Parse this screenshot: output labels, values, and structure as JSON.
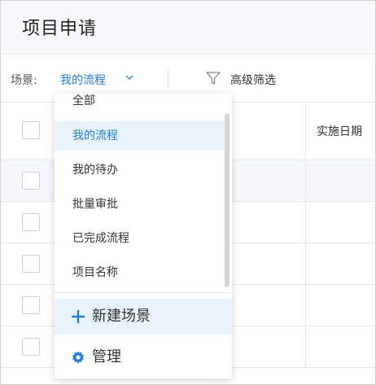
{
  "page": {
    "title": "项目申请"
  },
  "filter_bar": {
    "scene_label": "场景:",
    "scene_value": "我的流程",
    "advanced_filter_label": "高级筛选"
  },
  "table": {
    "header_date_label": "实施日期"
  },
  "scene_dropdown": {
    "items": [
      "全部",
      "我的流程",
      "我的待办",
      "批量审批",
      "已完成流程",
      "项目名称"
    ],
    "selected": "我的流程",
    "new_scene_label": "新建场景",
    "manage_label": "管理"
  },
  "colors": {
    "accent": "#1e7fe6",
    "selected_bg": "#e8f3fc"
  },
  "icons": {
    "chevron": "chevron-down-icon",
    "filter": "filter-icon",
    "plus": "plus-icon",
    "gear": "gear-icon"
  }
}
